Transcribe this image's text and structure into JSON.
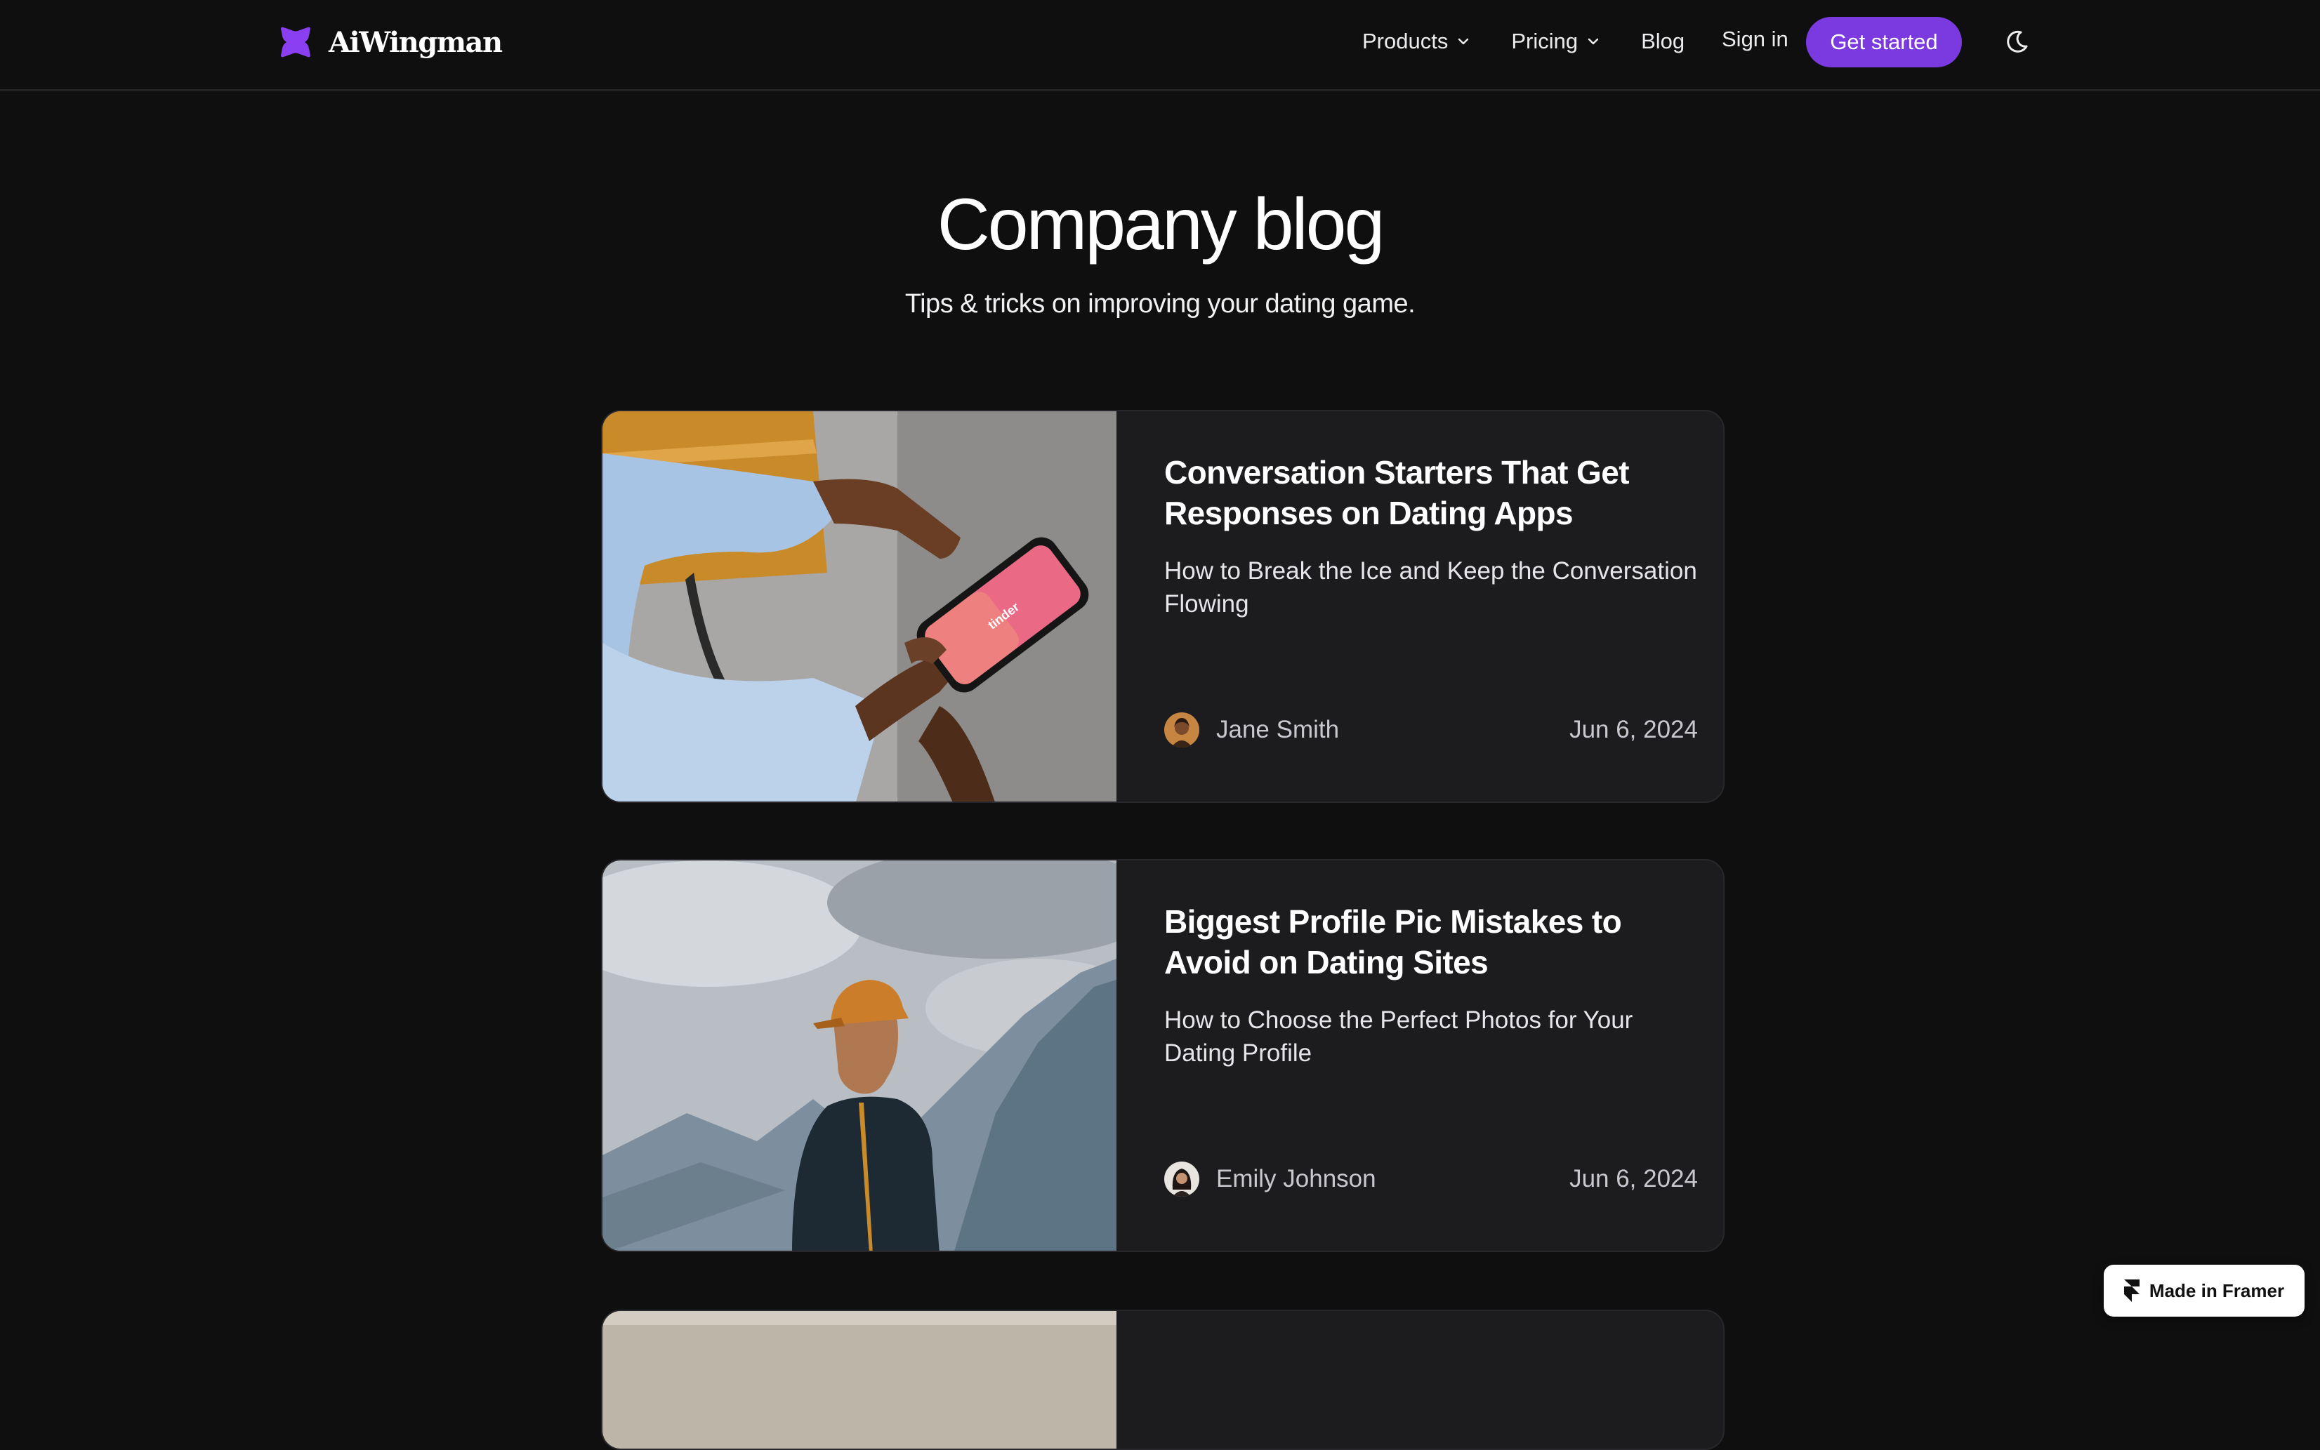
{
  "brand": {
    "name": "AiWingman"
  },
  "nav": {
    "products": "Products",
    "pricing": "Pricing",
    "blog": "Blog",
    "signin": "Sign in",
    "cta": "Get started"
  },
  "colors": {
    "accent": "#7a3ae0",
    "background": "#0f0f10",
    "card": "#1c1b1e"
  },
  "hero": {
    "title": "Company blog",
    "subtitle": "Tips & tricks on improving your dating game."
  },
  "posts": [
    {
      "title": "Conversation Starters That Get Responses on Dating Apps",
      "excerpt": "How to Break the Ice and Keep the Conversation Flowing",
      "author": "Jane Smith",
      "date": "Jun 6, 2024",
      "image": "hands-holding-phone-photo"
    },
    {
      "title": "Biggest Profile Pic Mistakes to Avoid on Dating Sites",
      "excerpt": "How to Choose the Perfect Photos for Your Dating Profile",
      "author": "Emily Johnson",
      "date": "Jun 6, 2024",
      "image": "man-in-cap-mountains-photo"
    }
  ],
  "badge": {
    "label": "Made in Framer"
  }
}
